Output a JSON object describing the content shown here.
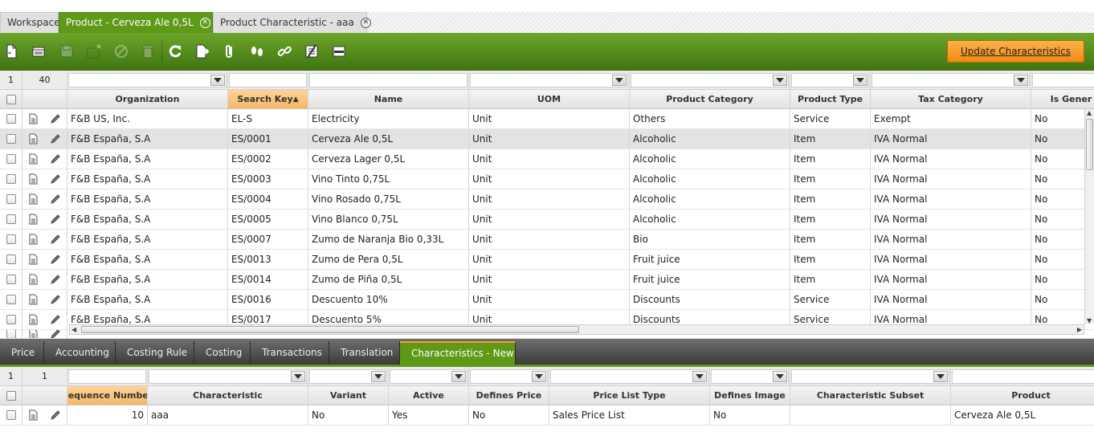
{
  "top_tabs": [
    {
      "label": "Workspace",
      "active": false,
      "closable": false
    },
    {
      "label": "Product - Cerveza Ale 0,5L",
      "active": true,
      "closable": true
    },
    {
      "label": "Product Characteristic - aaa",
      "active": false,
      "closable": true
    }
  ],
  "toolbar": {
    "buttons": [
      {
        "icon": "new-document-icon",
        "enabled": true
      },
      {
        "icon": "new-in-grid-icon",
        "enabled": true
      },
      {
        "icon": "save-icon",
        "enabled": false
      },
      {
        "icon": "delete-row-icon",
        "enabled": false
      },
      {
        "icon": "undo-icon",
        "enabled": false
      },
      {
        "icon": "trash-icon",
        "enabled": false
      },
      {
        "icon": "refresh-icon",
        "enabled": true
      },
      {
        "icon": "export-icon",
        "enabled": true
      },
      {
        "icon": "attachment-icon",
        "enabled": true
      },
      {
        "icon": "footprints-icon",
        "enabled": true
      },
      {
        "icon": "link-icon",
        "enabled": true
      },
      {
        "icon": "tree-icon",
        "enabled": true
      },
      {
        "icon": "form-view-icon",
        "enabled": true
      }
    ],
    "update_label": "Update Characteristics"
  },
  "main_grid": {
    "filter_selected": "1",
    "filter_total": "40",
    "columns": [
      "Organization",
      "Search Key",
      "Name",
      "UOM",
      "Product Category",
      "Product Type",
      "Tax Category",
      "Is Gener"
    ],
    "sorted_column_index": 1,
    "sort_indicator": "▲",
    "rows": [
      [
        "F&B US, Inc.",
        "EL-S",
        "Electricity",
        "Unit",
        "Others",
        "Service",
        "Exempt",
        "No"
      ],
      [
        "F&B España, S.A",
        "ES/0001",
        "Cerveza Ale 0,5L",
        "Unit",
        "Alcoholic",
        "Item",
        "IVA Normal",
        "No"
      ],
      [
        "F&B España, S.A",
        "ES/0002",
        "Cerveza Lager 0,5L",
        "Unit",
        "Alcoholic",
        "Item",
        "IVA Normal",
        "No"
      ],
      [
        "F&B España, S.A",
        "ES/0003",
        "Vino Tinto 0,75L",
        "Unit",
        "Alcoholic",
        "Item",
        "IVA Normal",
        "No"
      ],
      [
        "F&B España, S.A",
        "ES/0004",
        "Vino Rosado 0,75L",
        "Unit",
        "Alcoholic",
        "Item",
        "IVA Normal",
        "No"
      ],
      [
        "F&B España, S.A",
        "ES/0005",
        "Vino Blanco 0,75L",
        "Unit",
        "Alcoholic",
        "Item",
        "IVA Normal",
        "No"
      ],
      [
        "F&B España, S.A",
        "ES/0007",
        "Zumo de Naranja Bio 0,33L",
        "Unit",
        "Bio",
        "Item",
        "IVA Normal",
        "No"
      ],
      [
        "F&B España, S.A",
        "ES/0013",
        "Zumo de Pera 0,5L",
        "Unit",
        "Fruit juice",
        "Item",
        "IVA Normal",
        "No"
      ],
      [
        "F&B España, S.A",
        "ES/0014",
        "Zumo de Piña 0,5L",
        "Unit",
        "Fruit juice",
        "Item",
        "IVA Normal",
        "No"
      ],
      [
        "F&B España, S.A",
        "ES/0016",
        "Descuento 10%",
        "Unit",
        "Discounts",
        "Service",
        "IVA Normal",
        "No"
      ],
      [
        "F&B España, S.A",
        "ES/0017",
        "Descuento 5%",
        "Unit",
        "Discounts",
        "Service",
        "IVA Normal",
        "No"
      ]
    ],
    "selected_row_index": 1
  },
  "sub_tabs": [
    {
      "label": "Price",
      "active": false
    },
    {
      "label": "Accounting",
      "active": false
    },
    {
      "label": "Costing Rule",
      "active": false
    },
    {
      "label": "Costing",
      "active": false
    },
    {
      "label": "Transactions",
      "active": false
    },
    {
      "label": "Translation",
      "active": false
    },
    {
      "label": "Characteristics - New",
      "active": true
    }
  ],
  "char_grid": {
    "filter_selected": "1",
    "filter_total": "1",
    "columns": [
      "Sequence Number",
      "Characteristic",
      "Variant",
      "Active",
      "Defines Price",
      "Price List Type",
      "Defines Image",
      "Characteristic Subset",
      "Product"
    ],
    "sorted_column_index": 0,
    "rows": [
      [
        "10",
        "aaa",
        "No",
        "Yes",
        "No",
        "Sales Price List",
        "No",
        "",
        "Cerveza Ale 0,5L"
      ]
    ]
  },
  "colors": {
    "accent_green": "#5e9a18",
    "toolbar_top": "#6da52a",
    "toolbar_bottom": "#3f7412",
    "update_button": "#f08a10",
    "sorted_header": "#f6b765"
  }
}
